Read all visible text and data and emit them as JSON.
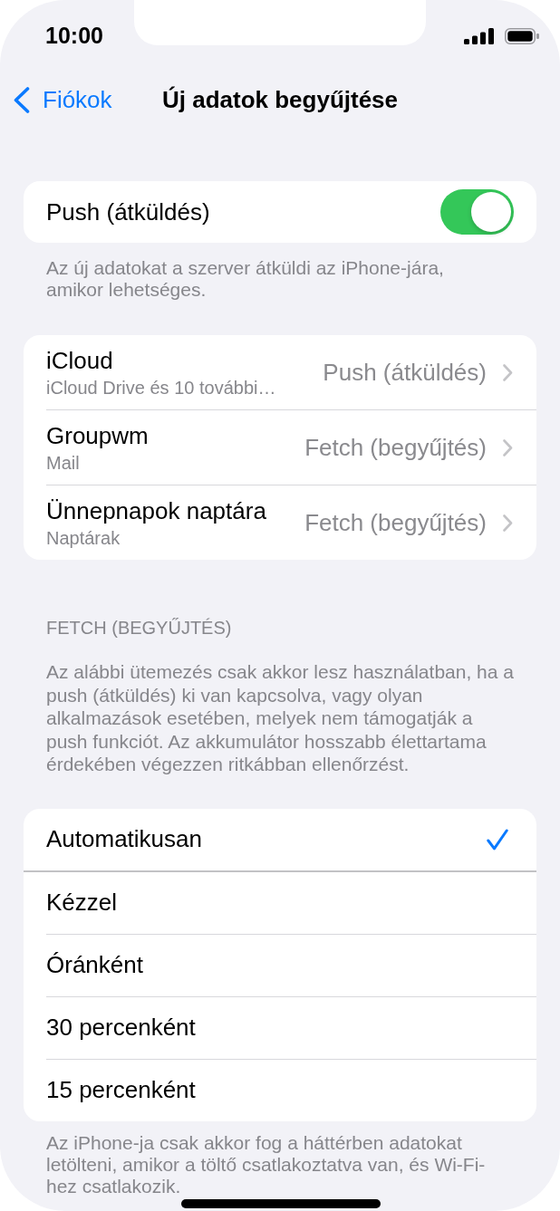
{
  "status_bar": {
    "time": "10:00"
  },
  "nav_bar": {
    "back_label": "Fiókok",
    "title": "Új adatok begyűjtése"
  },
  "push": {
    "label": "Push (átküldés)",
    "on": true,
    "footer": "Az új adatokat a szerver átküldi az iPhone-jára, amikor lehetséges."
  },
  "accounts": [
    {
      "name": "iCloud",
      "detail": "iCloud Drive és 10 további…",
      "value": "Push (átküldés)"
    },
    {
      "name": "Groupwm",
      "detail": "Mail",
      "value": "Fetch (begyűjtés)"
    },
    {
      "name": "Ünnepnapok naptára",
      "detail": "Naptárak",
      "value": "Fetch (begyűjtés)"
    }
  ],
  "fetch": {
    "header": "FETCH (BEGYŰJTÉS)",
    "description": "Az alábbi ütemezés csak akkor lesz használatban, ha a push (átküldés) ki van kapcsolva, vagy olyan alkalmazások esetében, melyek nem támogatják a push funkciót. Az akkumulátor hosszabb élettartama érdekében végezzen ritkábban ellenőrzést.",
    "options": [
      {
        "label": "Automatikusan",
        "selected": true
      },
      {
        "label": "Kézzel",
        "selected": false
      },
      {
        "label": "Óránként",
        "selected": false
      },
      {
        "label": "30 percenként",
        "selected": false
      },
      {
        "label": "15 percenként",
        "selected": false
      }
    ],
    "footer": "Az iPhone-ja csak akkor fog a háttérben adatokat letölteni, amikor a töltő csatlakoztatva van, és Wi-Fi-hez csatlakozik."
  }
}
